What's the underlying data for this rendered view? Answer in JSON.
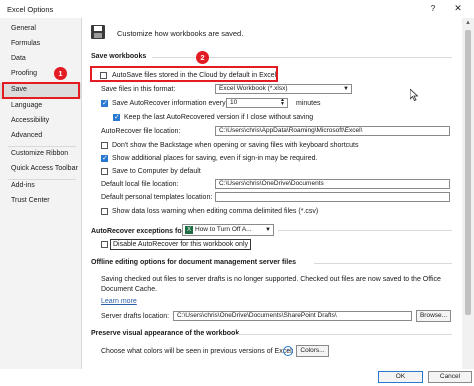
{
  "window": {
    "title": "Excel Options",
    "help": "?",
    "close": "✕"
  },
  "sidebar": {
    "items": [
      "General",
      "Formulas",
      "Data",
      "Proofing",
      "Save",
      "Language",
      "Accessibility",
      "Advanced",
      "Customize Ribbon",
      "Quick Access Toolbar",
      "Add-ins",
      "Trust Center"
    ],
    "selected": "Save"
  },
  "badges": {
    "one": "1",
    "two": "2"
  },
  "header": {
    "text": "Customize how workbooks are saved."
  },
  "save_workbooks": {
    "heading": "Save workbooks",
    "autosave_label": "AutoSave files stored in the Cloud by default in Excel",
    "autosave_checked": false,
    "format_label": "Save files in this format:",
    "format_value": "Excel Workbook (*.xlsx)",
    "autorecover_label": "Save AutoRecover information every",
    "autorecover_minutes": "10",
    "minutes_label": "minutes",
    "keep_last_label": "Keep the last AutoRecovered version if I close without saving",
    "ar_location_label": "AutoRecover file location:",
    "ar_location_value": "C:\\Users\\chris\\AppData\\Roaming\\Microsoft\\Excel\\",
    "backstage_label": "Don't show the Backstage when opening or saving files with keyboard shortcuts",
    "additional_places_label": "Show additional places for saving, even if sign-in may be required.",
    "save_to_computer_label": "Save to Computer by default",
    "default_local_label": "Default local file location:",
    "default_local_value": "C:\\Users\\chris\\OneDrive\\Documents",
    "personal_templates_label": "Default personal templates location:",
    "personal_templates_value": "",
    "data_loss_label": "Show data loss warning when editing comma delimited files (*.csv)"
  },
  "autorecover_exceptions": {
    "label": "AutoRecover exceptions for:",
    "workbook": "How to Turn Off A...",
    "disable_label": "Disable AutoRecover for this workbook only"
  },
  "offline": {
    "heading": "Offline editing options for document management server files",
    "description_line1": "Saving checked out files to server drafts is no longer supported. Checked out files are now saved to the Office",
    "description_line2": "Document Cache.",
    "learn_more": "Learn more",
    "server_drafts_label": "Server drafts location:",
    "server_drafts_value": "C:\\Users\\chris\\OneDrive\\Documents\\SharePoint Drafts\\",
    "browse_label": "Browse..."
  },
  "preserve": {
    "heading": "Preserve visual appearance of the workbook",
    "colors_text": "Choose what colors will be seen in previous versions of Excel:",
    "colors_button": "Colors..."
  },
  "footer": {
    "ok": "OK",
    "cancel": "Cancel"
  },
  "colors": {
    "accent": "#2b78d0",
    "annotation": "#e31b23",
    "excel_green": "#1d6f42"
  }
}
